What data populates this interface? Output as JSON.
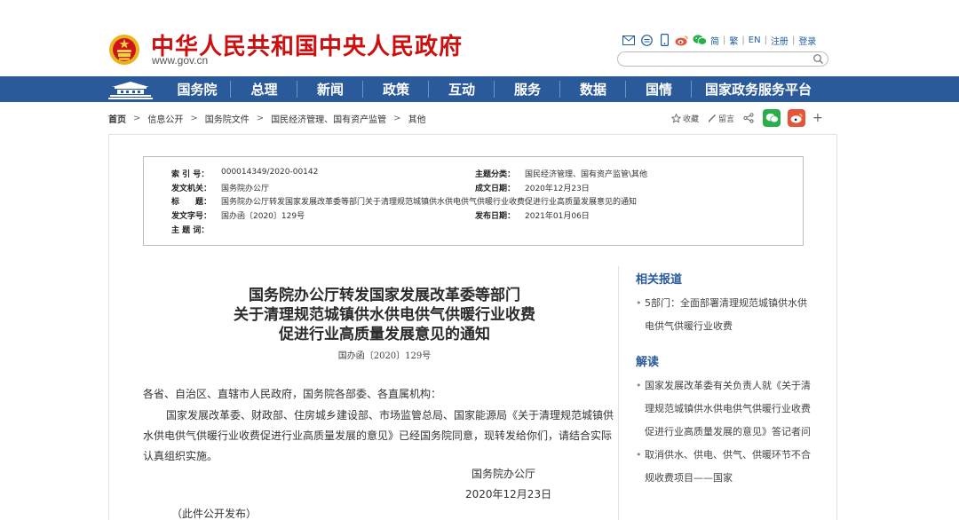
{
  "header": {
    "title": "中华人民共和国中央人民政府",
    "domain": "www.gov.cn",
    "links": [
      "简",
      "繁",
      "EN",
      "注册",
      "登录"
    ],
    "search_placeholder": ""
  },
  "nav": {
    "items": [
      "国务院",
      "总理",
      "新闻",
      "政策",
      "互动",
      "服务",
      "数据",
      "国情",
      "国家政务服务平台"
    ],
    "bg_color": "#2a5a9a"
  },
  "breadcrumb": [
    "首页",
    "信息公开",
    "国务院文件",
    "国民经济管理、国有资产监管",
    "其他"
  ],
  "tools": {
    "favorite": "收藏",
    "comment": "留言"
  },
  "info": {
    "index_label": "索 引 号：",
    "index_value": "000014349/2020-00142",
    "category_label": "主题分类：",
    "category_value": "国民经济管理、国有资产监管\\其他",
    "issuer_label": "发文机关：",
    "issuer_value": "国务院办公厅",
    "written_label": "成文日期：",
    "written_value": "2020年12月23日",
    "title_label": "标　　题：",
    "title_value": "国务院办公厅转发国家发展改革委等部门关于清理规范城镇供水供电供气供暖行业收费促进行业高质量发展意见的通知",
    "docno_label": "发文字号：",
    "docno_value": "国办函〔2020〕129号",
    "published_label": "发布日期：",
    "published_value": "2021年01月06日",
    "keywords_label": "主 题 词：",
    "keywords_value": ""
  },
  "article": {
    "title_line1": "国务院办公厅转发国家发展改革委等部门",
    "title_line2": "关于清理规范城镇供水供电供气供暖行业收费",
    "title_line3": "促进行业高质量发展意见的通知",
    "doc_number": "国办函〔2020〕129号",
    "para1": "各省、自治区、直辖市人民政府，国务院各部委、各直属机构：",
    "para2": "国家发展改革委、财政部、住房城乡建设部、市场监管总局、国家能源局《关于清理规范城镇供水供电供气供暖行业收费促进行业高质量发展的意见》已经国务院同意，现转发给你们，请结合实际认真组织实施。",
    "signer": "国务院办公厅",
    "date": "2020年12月23日",
    "note": "（此件公开发布）"
  },
  "sidebar": {
    "related_title": "相关报道",
    "related_items": [
      "5部门：全面部署清理规范城镇供水供电供气供暖行业收费"
    ],
    "interpret_title": "解读",
    "interpret_items": [
      "国家发展改革委有关负责人就《关于清理规范城镇供水供电供气供暖行业收费促进行业高质量发展的意见》答记者问",
      "取消供水、供电、供气、供暖环节不合规收费项目——国家"
    ]
  },
  "colors": {
    "brand_red": "#cc0f0f",
    "link_blue": "#1d5ea6",
    "wechat_green": "#27b04a",
    "weibo_red": "#e6553a"
  }
}
